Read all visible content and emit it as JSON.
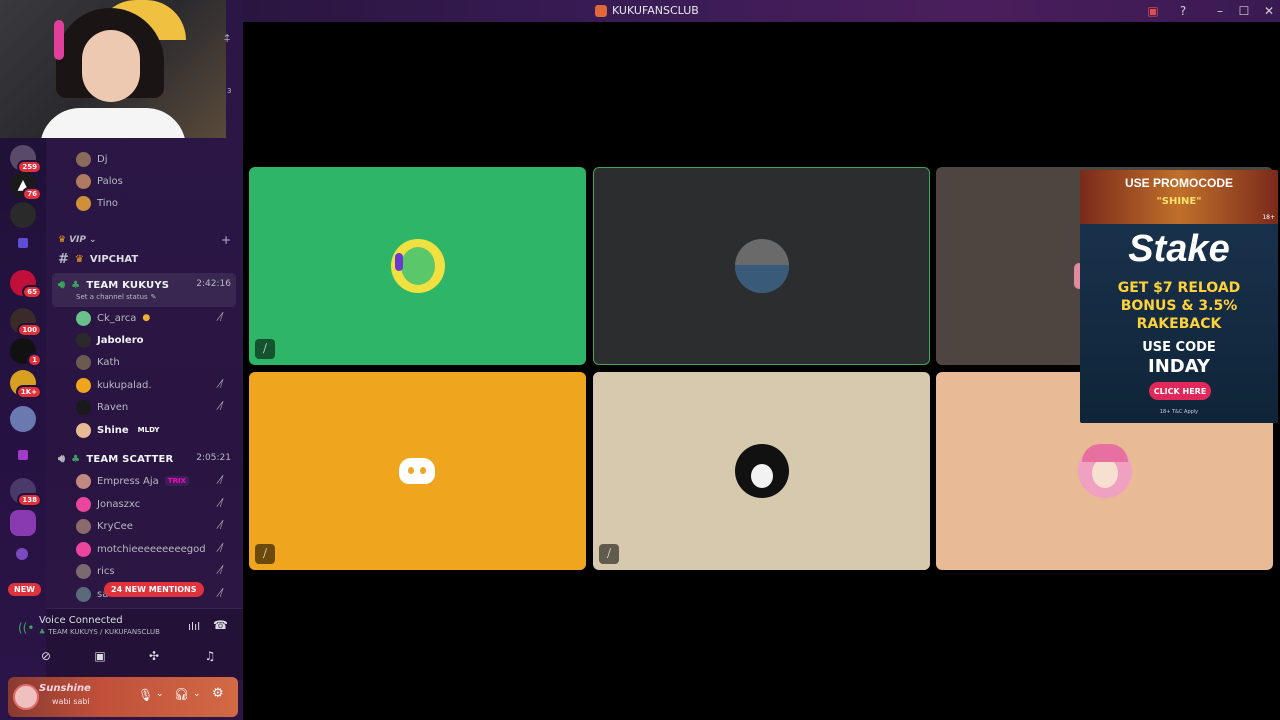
{
  "window": {
    "title": "KUKUFANSCLUB"
  },
  "rail": {
    "badges": [
      "259",
      "76",
      "65",
      "100",
      "1",
      "1K+",
      "138"
    ],
    "new_label": "NEW"
  },
  "sidebar": {
    "top_members": [
      {
        "name": "Dj"
      },
      {
        "name": "Palos"
      },
      {
        "name": "Tino"
      }
    ],
    "category_label": "VIP",
    "text_channel": "VIPCHAT",
    "webcam_overlay_number": "3",
    "voice_channels": [
      {
        "name": "TEAM KUKUYS",
        "time": "2:42:16",
        "status": "Set a channel status",
        "members": [
          {
            "name": "Ck_arca",
            "muted": true
          },
          {
            "name": "Jabolero",
            "muted": false,
            "bold": true
          },
          {
            "name": "Kath",
            "muted": false
          },
          {
            "name": "kukupalad.",
            "muted": true
          },
          {
            "name": "Raven",
            "muted": true
          },
          {
            "name": "Shine",
            "muted": false,
            "bold": true,
            "tag": "MLDY"
          }
        ]
      },
      {
        "name": "TEAM SCATTER",
        "time": "2:05:21",
        "members": [
          {
            "name": "Empress Aja",
            "muted": true,
            "tag": "TRIX"
          },
          {
            "name": "Jonaszxc",
            "muted": true
          },
          {
            "name": "KryCee",
            "muted": true
          },
          {
            "name": "motchieeeeeeeeegod",
            "muted": true
          },
          {
            "name": "rics",
            "muted": true
          },
          {
            "name": "sa",
            "muted": true
          }
        ]
      }
    ],
    "mentions_label": "24 NEW MENTIONS"
  },
  "voice": {
    "status": "Voice Connected",
    "location": "TEAM KUKUYS / KUKUFANSCLUB"
  },
  "user": {
    "name": "Sunshine",
    "status": "wabi sabi"
  },
  "ad": {
    "promo_line1": "USE PROMOCODE",
    "promo_line2": "\"SHINE\"",
    "brand": "Stake",
    "offer_line1": "GET $7 RELOAD",
    "offer_line2": "BONUS & 3.5%",
    "offer_line3": "RAKEBACK",
    "code_line1": "USE CODE",
    "code_line2": "INDAY",
    "cta": "CLICK HERE",
    "fineprint": "18+ T&C Apply",
    "age_badge": "18+"
  },
  "colors": {
    "tile_green": "#2fb567",
    "tile_dark": "#2b2d2f",
    "tile_taupe": "#4e4540",
    "tile_orange": "#f0a51f",
    "tile_beige": "#d7c9ae",
    "tile_peach": "#e8bb96",
    "badge_red": "#e0323c",
    "speaking_green": "#3ba55d"
  }
}
